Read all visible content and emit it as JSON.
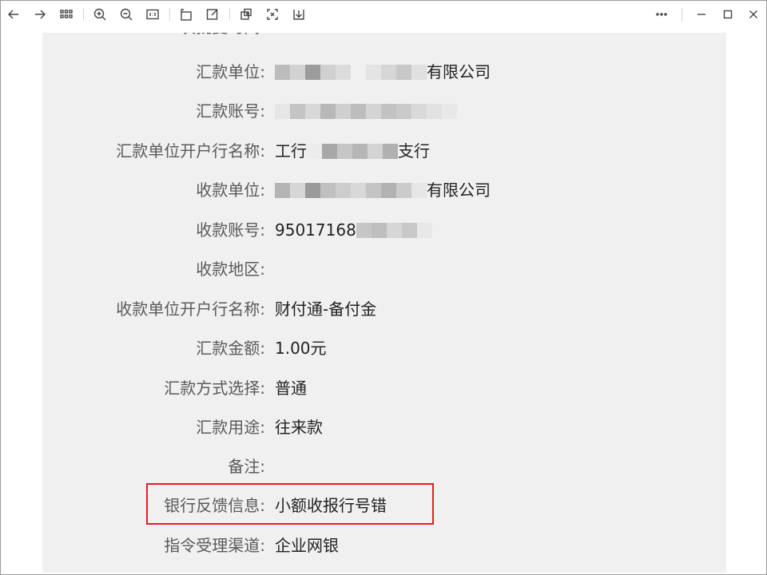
{
  "toolbar": {
    "icons": [
      "back-arrow-icon",
      "forward-arrow-icon",
      "grid-icon",
      "zoom-in-icon",
      "zoom-out-icon",
      "actual-size-icon",
      "rotate-icon",
      "edit-icon",
      "crop-icon",
      "fullscreen-icon",
      "download-icon",
      "more-icon",
      "minimize-icon",
      "maximize-icon",
      "close-icon"
    ]
  },
  "partial_row": {
    "label": "二次批复时间:"
  },
  "fields": [
    {
      "label": "汇款单位:",
      "value_suffix": "有限公司",
      "blurred": true
    },
    {
      "label": "汇款账号:",
      "value_suffix": "",
      "blurred": true
    },
    {
      "label": "汇款单位开户行名称:",
      "value_prefix": "工行",
      "value_suffix": "支行",
      "blurred": true
    },
    {
      "label": "收款单位:",
      "value_suffix": "有限公司",
      "blurred": true
    },
    {
      "label": "收款账号:",
      "value_prefix": "95017168",
      "blurred": true
    },
    {
      "label": "收款地区:",
      "value": ""
    },
    {
      "label": "收款单位开户行名称:",
      "value": "财付通-备付金"
    },
    {
      "label": "汇款金额:",
      "value": "1.00元"
    },
    {
      "label": "汇款方式选择:",
      "value": "普通"
    },
    {
      "label": "汇款用途:",
      "value": "往来款"
    },
    {
      "label": "备注:",
      "value": ""
    },
    {
      "label": "银行反馈信息:",
      "value": "小额收报行号错"
    },
    {
      "label": "指令受理渠道:",
      "value": "企业网银"
    }
  ],
  "colors": {
    "highlight_border": "#e0202a",
    "panel_bg": "#f0f0f0",
    "label_text": "#5a5a5a"
  }
}
